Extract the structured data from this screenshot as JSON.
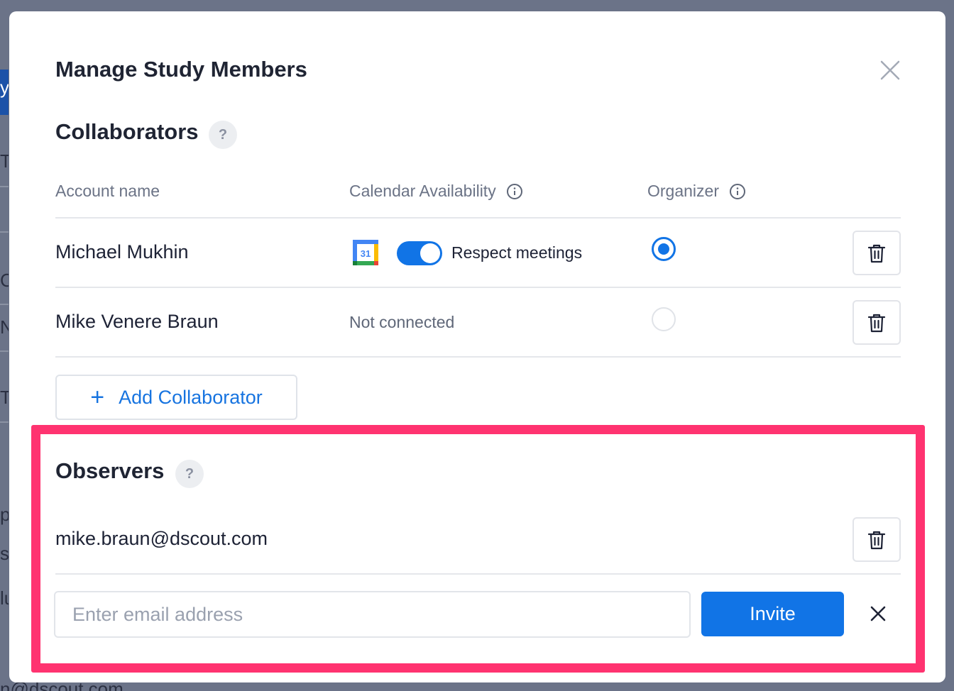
{
  "background": {
    "fragments": [
      "y",
      "To",
      "Co",
      "Ne",
      "Ty",
      "pe",
      "s",
      "lu"
    ],
    "bottom_text": "n@dscout.com"
  },
  "modal": {
    "title": "Manage Study Members"
  },
  "collaborators": {
    "title": "Collaborators",
    "help": "?",
    "columns": {
      "account_name": "Account name",
      "calendar_availability": "Calendar Availability",
      "organizer": "Organizer"
    },
    "rows": [
      {
        "name": "Michael Mukhin",
        "calendar_icon_text": "31",
        "calendar_toggle": true,
        "calendar_status": "Respect meetings",
        "organizer": true
      },
      {
        "name": "Mike Venere Braun",
        "calendar_status": "Not connected",
        "organizer": false
      }
    ],
    "add_button": {
      "icon": "+",
      "label": "Add Collaborator"
    }
  },
  "observers": {
    "title": "Observers",
    "help": "?",
    "items": [
      {
        "email": "mike.braun@dscout.com"
      }
    ],
    "input": {
      "value": "",
      "placeholder": "Enter email address"
    },
    "invite_label": "Invite"
  },
  "colors": {
    "accent": "#1174e6",
    "highlight": "#ff3370",
    "overlay": "#6b7388"
  }
}
